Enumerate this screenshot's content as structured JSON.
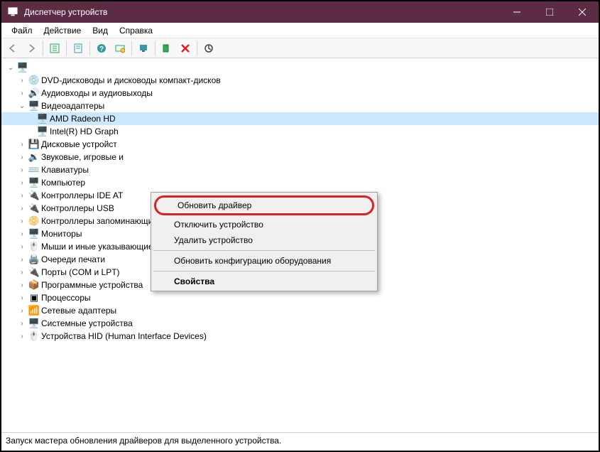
{
  "window": {
    "title": "Диспетчер устройств"
  },
  "menubar": {
    "file": "Файл",
    "action": "Действие",
    "view": "Вид",
    "help": "Справка"
  },
  "tree": {
    "root_label": "",
    "cat_dvd": "DVD-дисководы и дисководы компакт-дисков",
    "cat_audio": "Аудиовходы и аудиовыходы",
    "cat_video": "Видеоадаптеры",
    "dev_amd": "AMD Radeon HD",
    "dev_intel": "Intel(R) HD Graph",
    "cat_disk": "Дисковые устройст",
    "cat_sound": "Звуковые, игровые и",
    "cat_keyboard": "Клавиатуры",
    "cat_computer": "Компьютер",
    "cat_ide": "Контроллеры IDE AT",
    "cat_usb": "Контроллеры USB",
    "cat_storage": "Контроллеры запоминающих устройств",
    "cat_monitors": "Мониторы",
    "cat_mice": "Мыши и иные указывающие устройства",
    "cat_printq": "Очереди печати",
    "cat_ports": "Порты (COM и LPT)",
    "cat_soft": "Программные устройства",
    "cat_cpu": "Процессоры",
    "cat_net": "Сетевые адаптеры",
    "cat_system": "Системные устройства",
    "cat_hid": "Устройства HID (Human Interface Devices)"
  },
  "context_menu": {
    "update_driver": "Обновить драйвер",
    "disable_device": "Отключить устройство",
    "uninstall_device": "Удалить устройство",
    "scan_hardware": "Обновить конфигурацию оборудования",
    "properties": "Свойства"
  },
  "statusbar": {
    "text": "Запуск мастера обновления драйверов для выделенного устройства."
  },
  "colors": {
    "titlebar": "#5b2c44",
    "highlight_border": "#e02020",
    "selection": "#cce8ff"
  }
}
